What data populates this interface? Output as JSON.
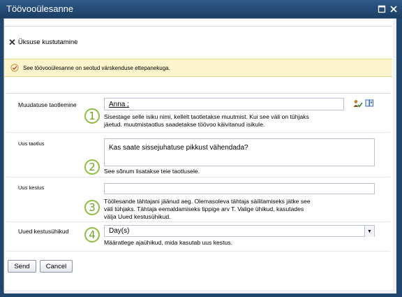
{
  "window": {
    "title": "Töövooülesanne"
  },
  "ribbon": {
    "delete_label": "Üksuse kustutamine"
  },
  "info": {
    "message": "See töövooülesanne on seotud värskenduse ettepanekuga."
  },
  "form": {
    "rows": [
      {
        "label": "Muudatuse taotlemine",
        "value": "Anna ;",
        "help_1": "Sisestage selle isiku nimi, kellelt taotletakse muutmist. Kui see väli on tühjaks",
        "help_2": "jäetud. muutmistaotlus saadetakse töövoo käivitanud isikule.",
        "badge": "1"
      },
      {
        "label": "Uus taotlus",
        "value": "Kas saate sissejuhatuse pikkust vähendada?",
        "help_1": "See sõnum lisatakse teie taotlusele.",
        "badge": "2"
      },
      {
        "label": "Uus kestus",
        "value": "",
        "help_1": "Töölesande tähtajani jäänud aeg. Olemasoleva tähtaja säilitamiseks jätke see",
        "help_2": "väli tühjaks. Tähtaja eemaldamiseks tippige arv T. Valige ühikud, kasutades",
        "help_3": "välja Uued kestusühikud.",
        "badge": "3"
      },
      {
        "label": "Uued kestusühikud",
        "value": "Day(s)",
        "help_1": "Määratlege ajaühikud, mida kasutab uus kestus.",
        "badge": "4"
      }
    ]
  },
  "buttons": {
    "send": "Send",
    "cancel": "Cancel"
  },
  "colors": {
    "titlebar": "#21466e",
    "info_bg": "#fcf4cc",
    "badge": "#8fbf3f"
  },
  "icons": {
    "maximize": "maximize-icon",
    "close": "close-icon",
    "delete": "x-icon",
    "info": "check-circle-icon",
    "people": "check-names-icon",
    "browse": "address-book-icon",
    "dropdown": "chevron-down-icon"
  }
}
